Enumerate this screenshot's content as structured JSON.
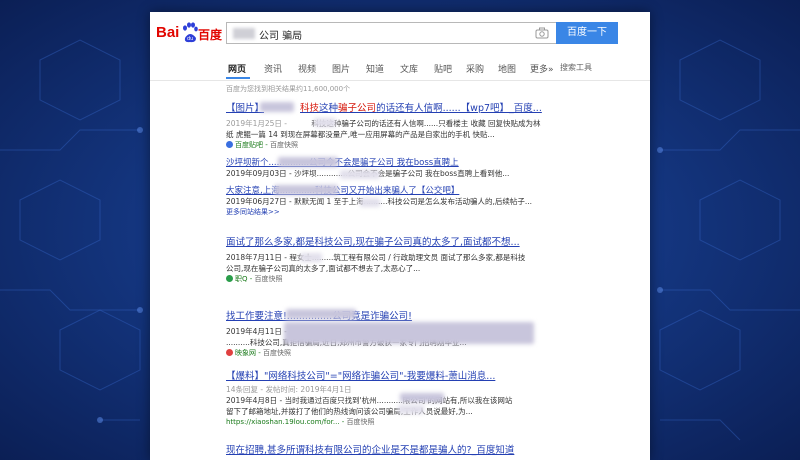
{
  "search": {
    "query": "公司 骗局",
    "button_label": "百度一下"
  },
  "logo": {
    "part1": "Bai",
    "part2": "百度"
  },
  "nav": {
    "tabs": [
      "网页",
      "资讯",
      "视频",
      "图片",
      "知道",
      "文库",
      "贴吧",
      "采购",
      "地图",
      "更多»"
    ],
    "active": "网页",
    "tools": "搜索工具"
  },
  "result_count": "百度为您找到相关结果约11,600,000个",
  "results": [
    {
      "title_pre": "【图片】",
      "title_kw1": "科技",
      "title_mid": "这种",
      "title_kw2": "骗子公司",
      "title_post": "的话还有人信啊......【wp7吧】_百度...",
      "line1_date": "2019年1月25日 - ",
      "line1": "科技这种骗子公司的话还有人信啊......只看楼主 收藏 回复快贴成为林",
      "line2": "纸 虎鲲一篇 14 到现在屏幕都没量产,唯一应用屏幕的产品是自家出的手机 快贴...",
      "source": "百度贴吧",
      "cache": "百度快照"
    },
    {
      "sub1_title": "沙坪坝新个...............公司今不会是骗子公司 我在boss直聘上",
      "sub1_text": "2019年09月03日 - 沙坪坝.............公司会不会是骗子公司 我在boss直聘上看到他...",
      "sub2_title": "大家注意,上海.............科技公司又开始出来骗人了【公交吧】",
      "sub2_text": "2019年06月27日 - 默默无闻 1 至于上海..........科技公司是怎么发布活动骗人的,后续帖子...",
      "more": "更多同站结果>>"
    },
    {
      "title": "面试了那么多家,都是科技公司,现在骗子公司真的太多了,面试都不想...",
      "line1": "2018年7月11日 - 程女士.........筑工程有限公司 / 行政助理文员 面试了那么多家,都是科技",
      "line2": "公司,现在骗子公司真的太多了,面试都不想去了,太恶心了...",
      "source": "职Q",
      "cache": "百度快照"
    },
    {
      "title": "找工作要注意!...............公司竟是诈骗公司!",
      "line1": "2019年4月11日 - ..................................打着'高薪'旗号专门招聘",
      "line2": "..........科技公司,真拒借骗局,近日,郑州市警方破获一家专门招聘刚毕业...",
      "source": "映象网",
      "cache": "百度快照"
    },
    {
      "title": "【爆料】\"网络科技公司\"=\"网络诈骗公司\"-我要爆料-萧山消息...",
      "meta": "14条回复 - 发帖时间: 2019年4月1日",
      "line1": "2019年4月8日 - 当时我通过百度只找到'杭州...........限公司'的网站有,所以我在该网站",
      "line2": "留下了邮箱地址,并拨打了他们的热线询问该公司骗局,工作人员说最好,为...",
      "source": "https://xiaoshan.19lou.com/for...",
      "cache": "百度快照"
    },
    {
      "title": "现在招聘,甚多所谓科技有限公司的企业是不是都是骗人的?_百度知道"
    }
  ],
  "colors": {
    "title_blue": "#2440b3",
    "keyword_red": "#d6180c",
    "source_green": "#1a7a1a",
    "button_blue": "#3a86e6",
    "logo_red": "#e10601"
  }
}
